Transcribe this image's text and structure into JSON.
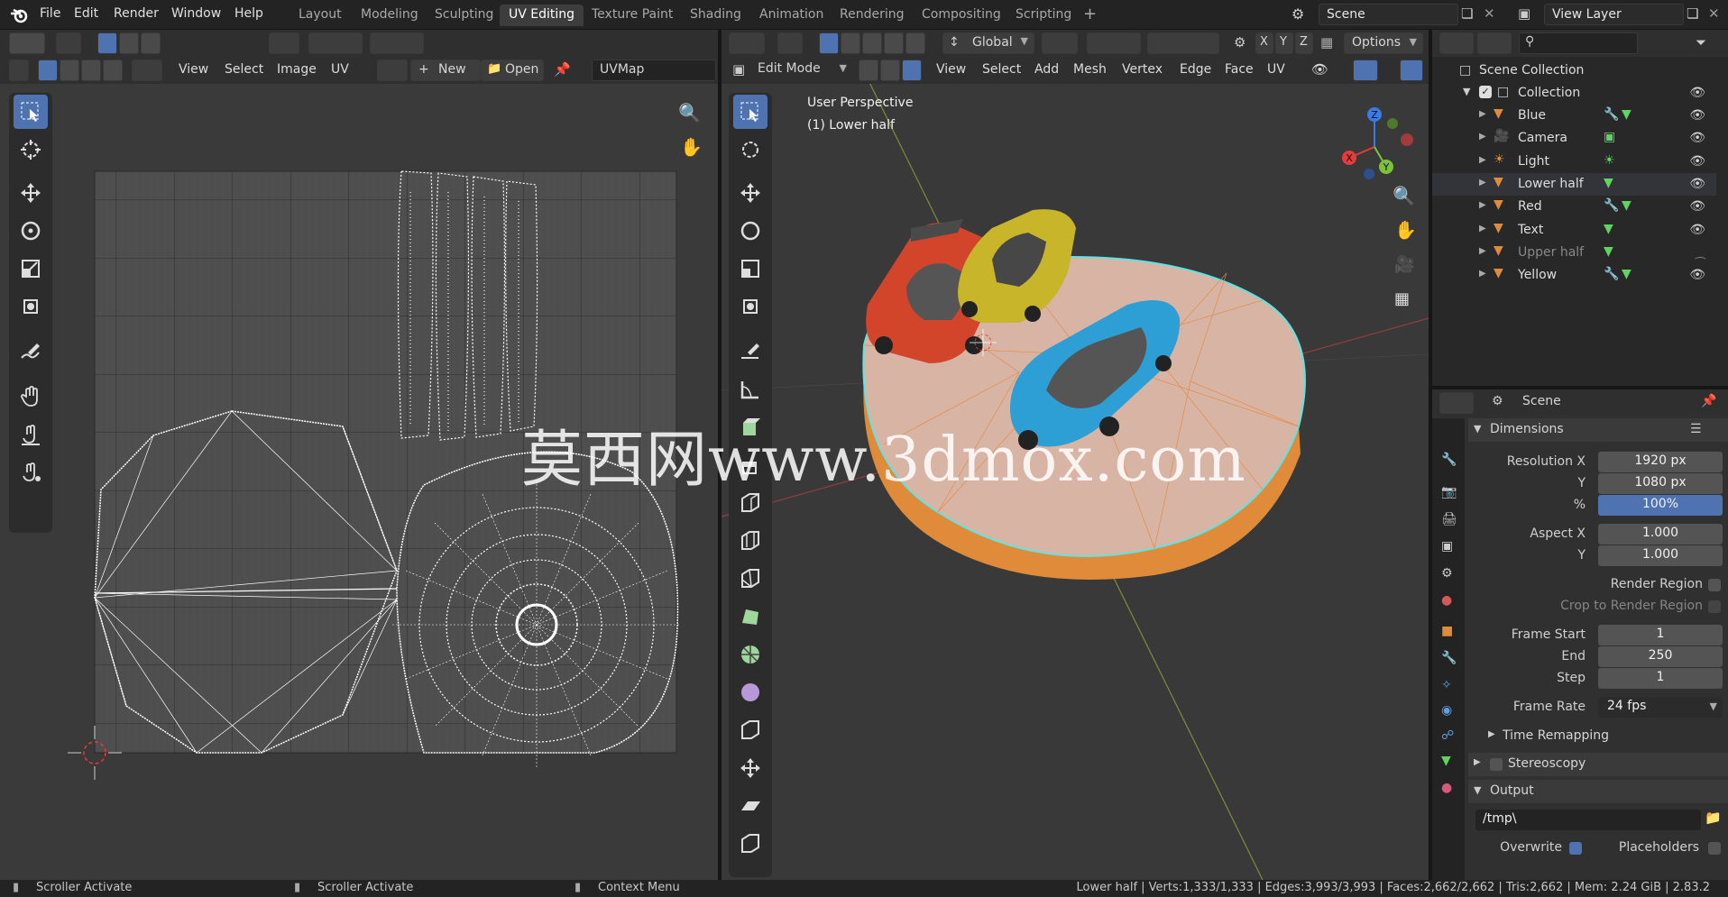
{
  "topbar": {
    "menus": [
      "File",
      "Edit",
      "Render",
      "Window",
      "Help"
    ],
    "workspaces": [
      "Layout",
      "Modeling",
      "Sculpting",
      "UV Editing",
      "Texture Paint",
      "Shading",
      "Animation",
      "Rendering",
      "Compositing",
      "Scripting"
    ],
    "active_workspace": "UV Editing",
    "add_tab": "+",
    "scene_name": "Scene",
    "view_layer": "View Layer"
  },
  "uv_editor": {
    "menus": [
      "View",
      "Select",
      "Image",
      "UV"
    ],
    "new_label": "New",
    "open_label": "Open",
    "uvmap_name": "UVMap"
  },
  "viewport": {
    "mode": "Edit Mode",
    "menus": [
      "View",
      "Select",
      "Add",
      "Mesh",
      "Vertex",
      "Edge",
      "Face",
      "UV"
    ],
    "orientation": "Global",
    "axes": [
      "X",
      "Y",
      "Z"
    ],
    "options_label": "Options",
    "overlay_title": "User Perspective",
    "overlay_object": "(1) Lower half",
    "gizmo": {
      "x": "X",
      "y": "Y",
      "z": "Z"
    }
  },
  "watermark": "莫西网www.3dmox.com",
  "outliner": {
    "scene_collection": "Scene Collection",
    "collection": "Collection",
    "items": [
      {
        "name": "Blue",
        "hidden": false
      },
      {
        "name": "Camera",
        "hidden": false
      },
      {
        "name": "Light",
        "hidden": false
      },
      {
        "name": "Lower half",
        "hidden": false
      },
      {
        "name": "Red",
        "hidden": false
      },
      {
        "name": "Text",
        "hidden": false
      },
      {
        "name": "Upper half",
        "hidden": true
      },
      {
        "name": "Yellow",
        "hidden": false
      }
    ]
  },
  "properties": {
    "context": "Scene",
    "dimensions_label": "Dimensions",
    "res_x_label": "Resolution X",
    "res_x": "1920 px",
    "res_y_label": "Y",
    "res_y": "1080 px",
    "pct_label": "%",
    "pct": "100%",
    "aspect_x_label": "Aspect X",
    "aspect_x": "1.000",
    "aspect_y_label": "Y",
    "aspect_y": "1.000",
    "render_region": "Render Region",
    "crop_region": "Crop to Render Region",
    "frame_start_label": "Frame Start",
    "frame_start": "1",
    "end_label": "End",
    "frame_end": "250",
    "step_label": "Step",
    "frame_step": "1",
    "frame_rate_label": "Frame Rate",
    "frame_rate": "24 fps",
    "time_remapping": "Time Remapping",
    "stereoscopy": "Stereoscopy",
    "output_label": "Output",
    "output_path": "/tmp\\",
    "overwrite": "Overwrite",
    "placeholders": "Placeholders"
  },
  "statusbar": {
    "left1": "Scroller Activate",
    "left2": "Scroller Activate",
    "left3": "Context Menu",
    "right": "Lower half | Verts:1,333/1,333 | Edges:3,993/3,993 | Faces:2,662/2,662 | Tris:2,662 | Mem: 2.24 GiB | 2.83.2"
  },
  "colors": {
    "accent": "#4f73b0",
    "edit_orange": "#e8873a",
    "car_red": "#d2452a",
    "car_yellow": "#c9b52a",
    "car_blue": "#2e9fd4",
    "platform": "#d9b3a3"
  }
}
